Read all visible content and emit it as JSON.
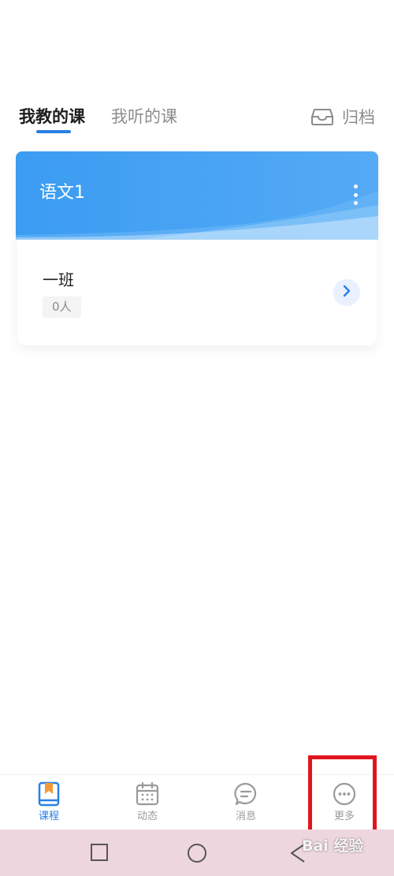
{
  "tabs": {
    "teaching_label": "我教的课",
    "attending_label": "我听的课",
    "archive_label": "归档"
  },
  "course_card": {
    "title": "语文1",
    "class_name": "一班",
    "member_count": "0人"
  },
  "bottom_nav": {
    "items": [
      {
        "label": "课程",
        "icon": "bookmark-book-icon",
        "active": true
      },
      {
        "label": "动态",
        "icon": "calendar-icon",
        "active": false
      },
      {
        "label": "消息",
        "icon": "chat-bubble-icon",
        "active": false
      },
      {
        "label": "更多",
        "icon": "more-dots-icon",
        "active": false
      }
    ]
  },
  "system_nav": {
    "icons": [
      "recent-apps-icon",
      "home-icon",
      "back-icon"
    ]
  },
  "watermark": {
    "text": "Bai 经验"
  },
  "colors": {
    "accent": "#2a7fe6",
    "card_blue": "#3b9cf2",
    "highlight": "#e0151d",
    "system_bar": "#edd6dd"
  }
}
